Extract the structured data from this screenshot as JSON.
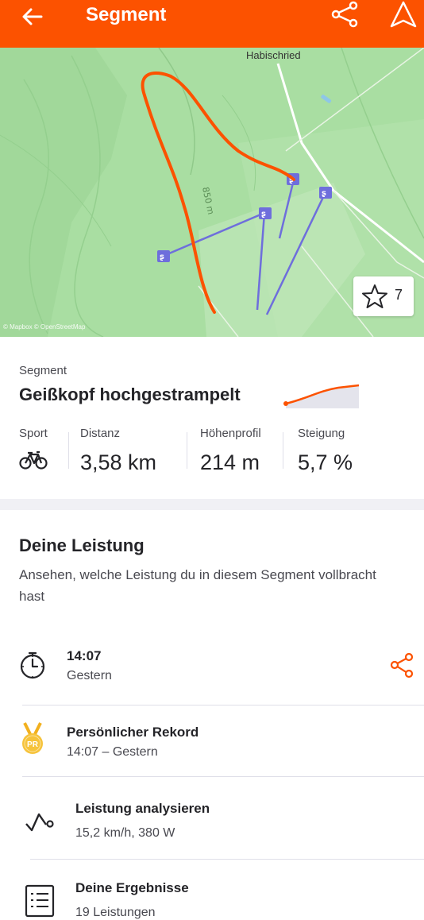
{
  "header": {
    "title": "Segment",
    "back_icon": "arrow-left-icon",
    "share_icon": "share-icon",
    "navigate_icon": "navigation-icon",
    "color": "#fc5200"
  },
  "map": {
    "place_label": "Habischried",
    "contour_label": "850 m",
    "attribution": "© Mapbox © OpenStreetMap",
    "star_count": "7",
    "route_color": "#fc5200",
    "lift_color": "#6e6edc"
  },
  "segment": {
    "label": "Segment",
    "name": "Geißkopf hochgestrampelt",
    "stats": [
      {
        "label": "Sport",
        "value": "",
        "icon": "bike-icon"
      },
      {
        "label": "Distanz",
        "value": "3,58 km"
      },
      {
        "label": "Höhenprofil",
        "value": "214 m"
      },
      {
        "label": "Steigung",
        "value": "5,7 %"
      }
    ]
  },
  "performance": {
    "title": "Deine Leistung",
    "description": "Ansehen, welche Leistung du in diesem Segment vollbracht hast",
    "rows": [
      {
        "title": "14:07",
        "subtitle": "Gestern",
        "icon": "stopwatch-icon"
      },
      {
        "title": "Persönlicher Rekord",
        "subtitle": "14:07 – Gestern",
        "icon": "pr-medal-icon"
      },
      {
        "title": "Leistung analysieren",
        "subtitle": "15,2 km/h, 380 W",
        "icon": "analysis-icon"
      },
      {
        "title": "Deine Ergebnisse",
        "subtitle": "19 Leistungen",
        "icon": "list-icon"
      }
    ]
  }
}
